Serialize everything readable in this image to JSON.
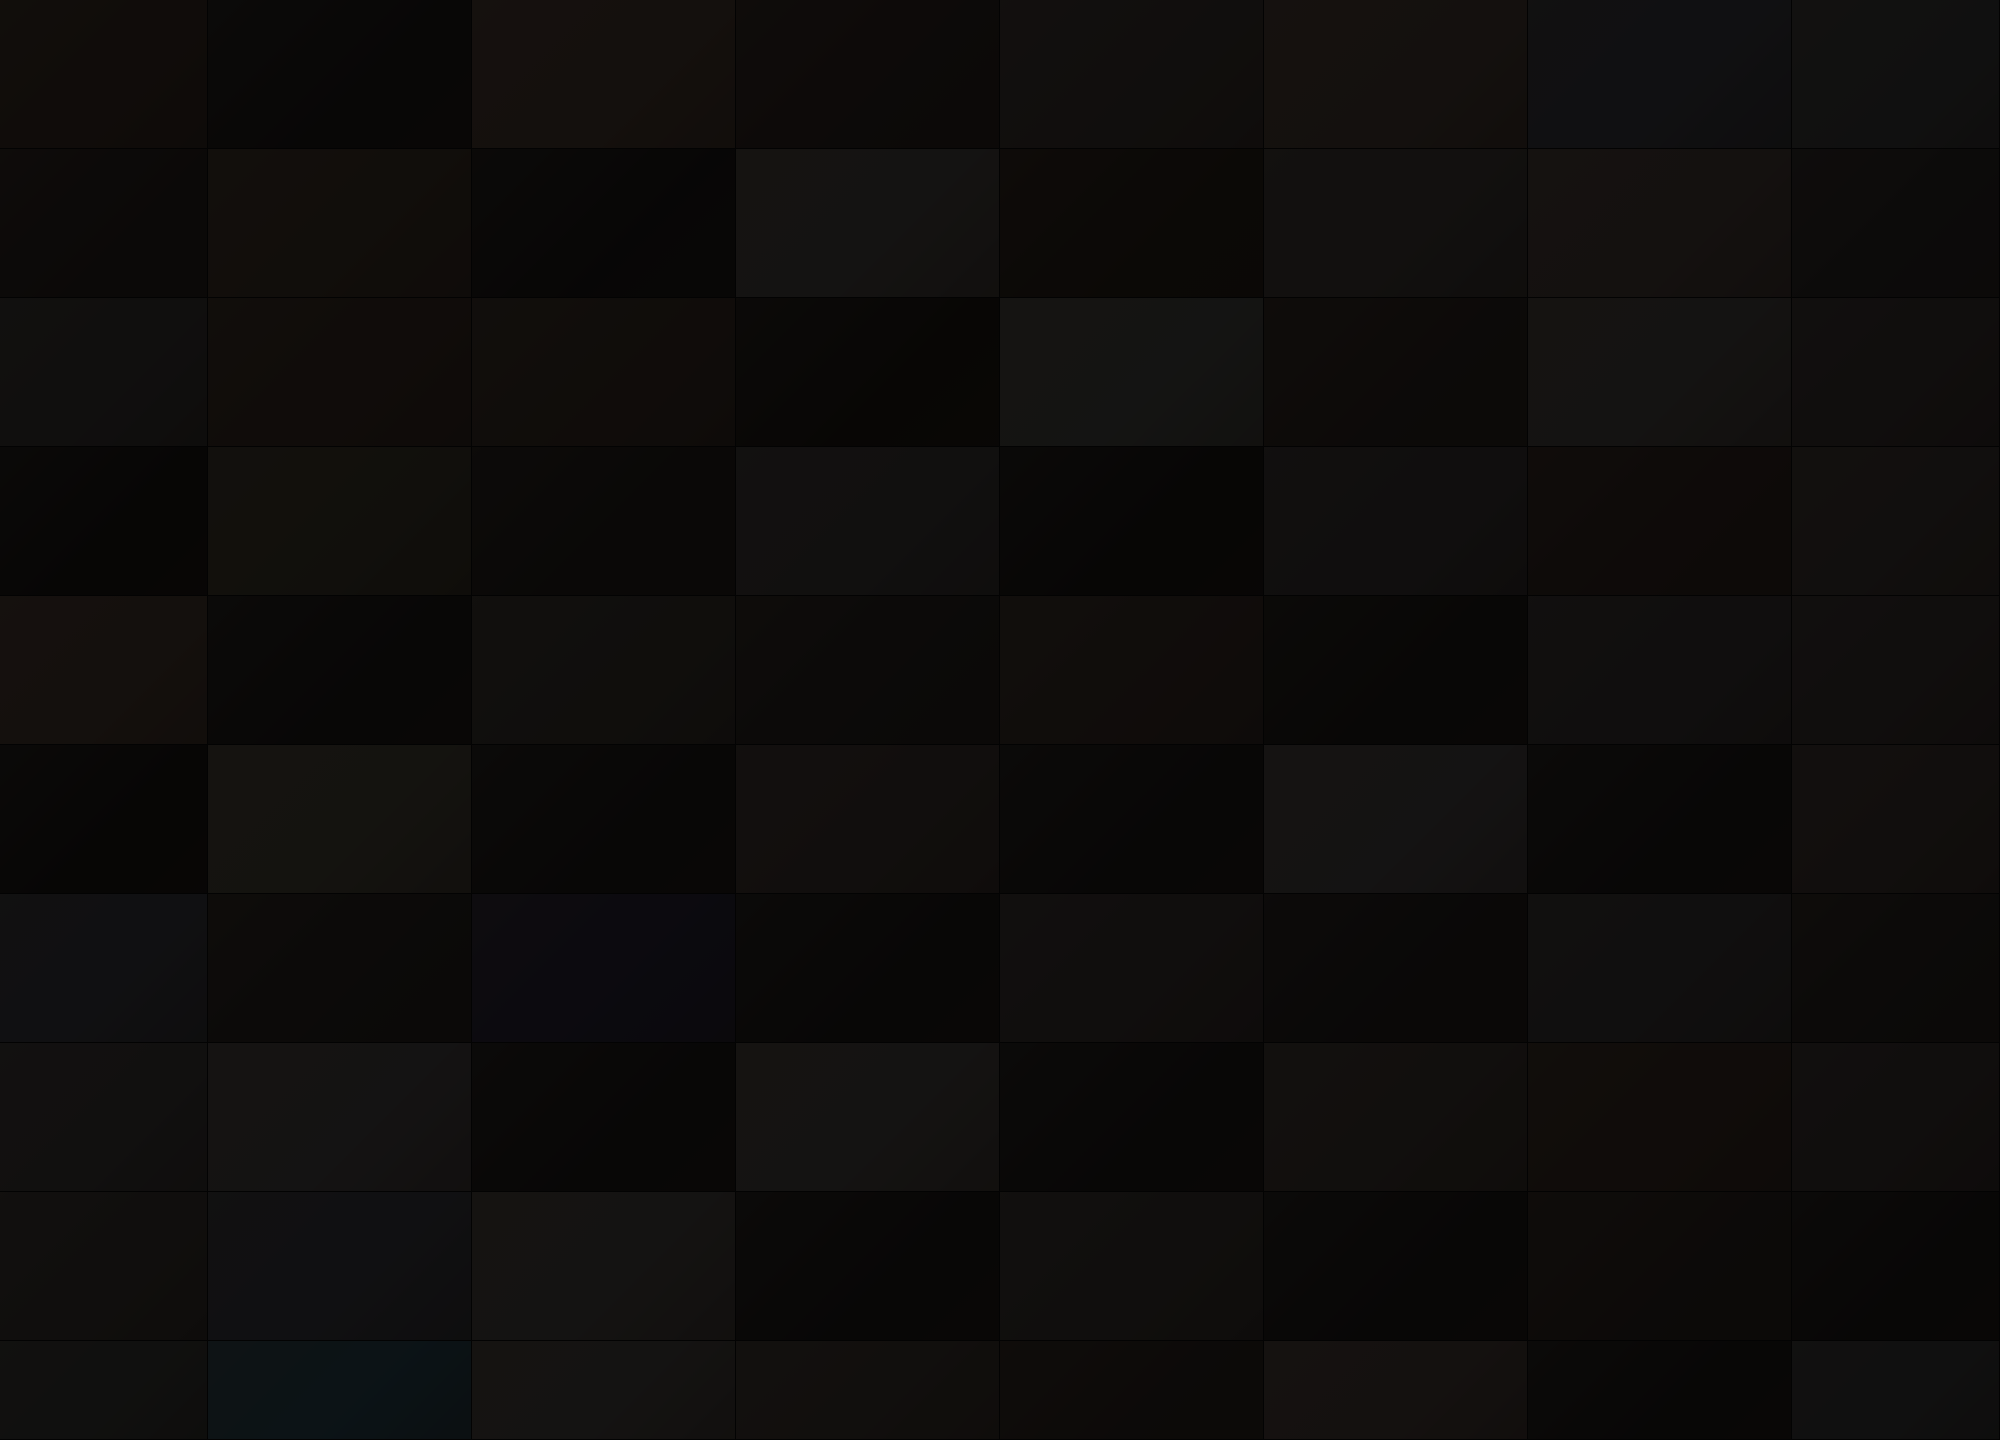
{
  "grid": {
    "columns": 8,
    "rows": 10,
    "tile_colors": [
      "#3a2c24",
      "#1e1a18",
      "#4a3a30",
      "#2e2420",
      "#3c3430",
      "#4a3c34",
      "#3a3a40",
      "#3c3c3c",
      "#2a221e",
      "#3e3228",
      "#1c1816",
      "#4a4440",
      "#2a2018",
      "#403a36",
      "#4a3e38",
      "#2c2826",
      "#3a3634",
      "#3a2c24",
      "#3a2e26",
      "#1e1814",
      "#4a4a44",
      "#2e2620",
      "#4a4440",
      "#3a3230",
      "#1a1614",
      "#3e382c",
      "#241e1a",
      "#3e3a38",
      "#1a1614",
      "#3a3434",
      "#322620",
      "#3e3632",
      "#4a3a30",
      "#1e1a18",
      "#3a342e",
      "#2a2420",
      "#3a2e28",
      "#1e1a16",
      "#3a3434",
      "#3a3230",
      "#1a1614",
      "#4a4438",
      "#1e1a18",
      "#3e3430",
      "#1e1a18",
      "#4a4444",
      "#1e1a18",
      "#3e3430",
      "#3a3a40",
      "#2a2420",
      "#2a2436",
      "#1e1a18",
      "#3a3230",
      "#241e1c",
      "#3a3636",
      "#2a2420",
      "#3e3a38",
      "#4a4444",
      "#1e1a18",
      "#4a4440",
      "#1e1a18",
      "#3e3630",
      "#3a2c24",
      "#3a3230",
      "#3a3430",
      "#3a3a40",
      "#4a4440",
      "#1e1a18",
      "#3a3430",
      "#1e1a18",
      "#2e2620",
      "#1e1a18",
      "#3a3a36",
      "#2a4450",
      "#4a4440",
      "#3e3630",
      "#2e2620",
      "#4a3e38",
      "#1e1a18",
      "#3a3a3a"
    ]
  }
}
